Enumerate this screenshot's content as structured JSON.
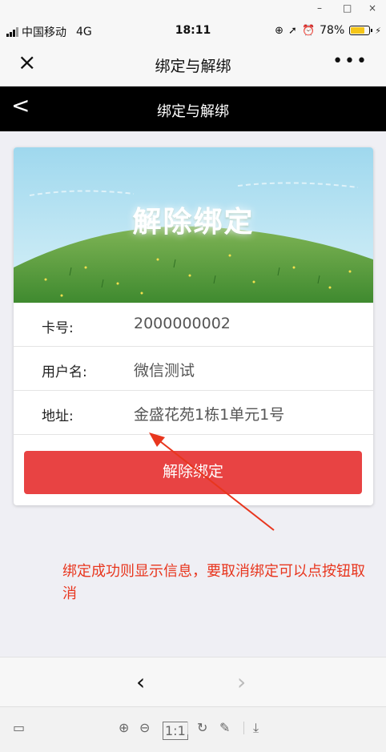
{
  "window": {
    "minimize": "–",
    "maximize": "□",
    "close": "×"
  },
  "status_bar": {
    "carrier": "中国移动",
    "network": "4G",
    "time": "18:11",
    "battery": "78%",
    "battery_level_pct": 78
  },
  "wx_nav": {
    "close_icon": "×",
    "title": "绑定与解绑",
    "more_icon": "•••"
  },
  "header": {
    "back_icon": "<",
    "title": "绑定与解绑"
  },
  "banner": {
    "title": "解除绑定"
  },
  "info": {
    "rows": [
      {
        "label": "卡号:",
        "value": "2000000002"
      },
      {
        "label": "用户名:",
        "value": "微信测试"
      },
      {
        "label": "地址:",
        "value": "金盛花苑1栋1单元1号"
      }
    ]
  },
  "actions": {
    "unbind_label": "解除绑定"
  },
  "annotation": {
    "text": "绑定成功则显示信息，要取消绑定可以点按钮取消"
  },
  "bottom_nav": {
    "prev_icon": "‹",
    "next_icon": "›"
  },
  "viewer_toolbar": {
    "fit_label": "1:1"
  },
  "colors": {
    "accent_red": "#e84343",
    "annotation_red": "#e8361e",
    "header_bg": "#000000"
  }
}
